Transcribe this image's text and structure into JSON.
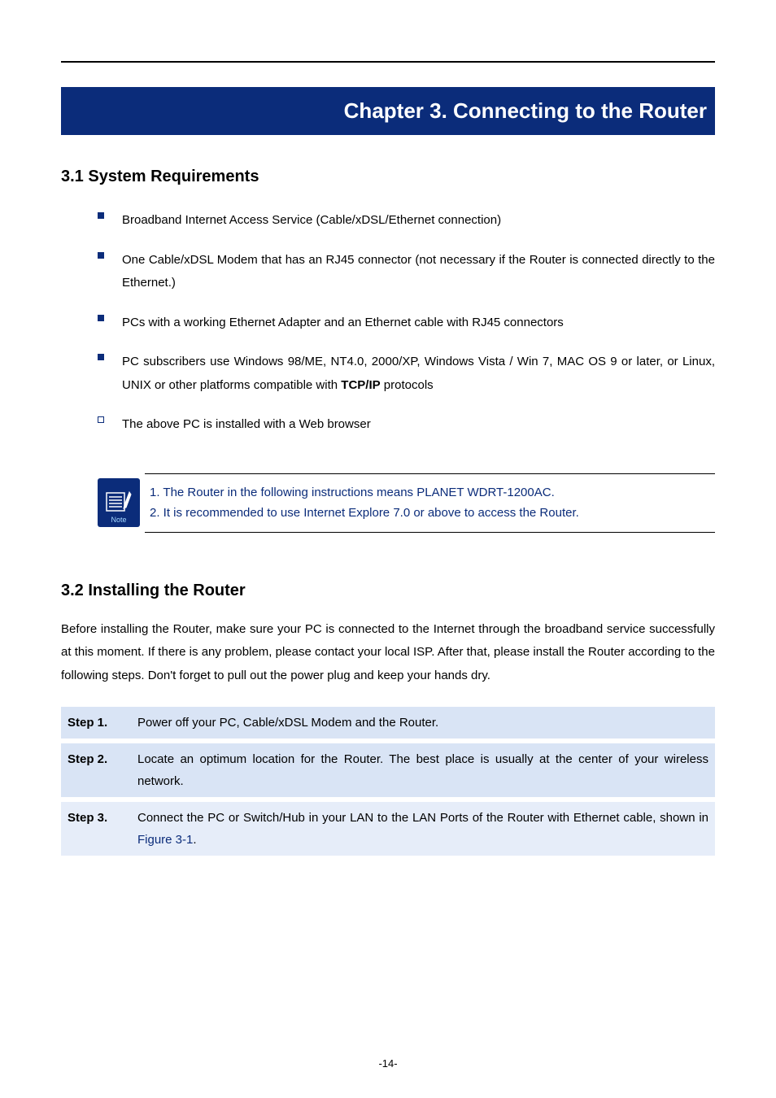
{
  "chapter": {
    "title": "Chapter 3. Connecting to the Router"
  },
  "s31": {
    "heading": "3.1  System Requirements",
    "items": {
      "i0": "Broadband Internet Access Service (Cable/xDSL/Ethernet connection)",
      "i1": "One Cable/xDSL Modem that has an RJ45 connector (not necessary if the Router is connected directly to the Ethernet.)",
      "i2": "PCs with a working Ethernet Adapter and an Ethernet cable with RJ45 connectors",
      "i3_pre": "PC subscribers use Windows 98/ME, NT4.0, 2000/XP, Windows Vista / Win 7, MAC OS 9 or later, or Linux, UNIX or other platforms compatible with ",
      "i3_bold": "TCP/IP",
      "i3_post": " protocols",
      "i4": "The above PC is installed with a Web browser"
    }
  },
  "note": {
    "label": "Note",
    "line1": "1. The Router in the following instructions means PLANET WDRT-1200AC.",
    "line2": "2. It is recommended to use Internet Explore 7.0 or above to access the Router."
  },
  "s32": {
    "heading": "3.2  Installing the Router",
    "intro": "Before installing the Router, make sure your PC is connected to the Internet through the broadband service successfully at this moment. If there is any problem, please contact your local ISP. After that, please install the Router according to the following steps. Don't forget to pull out the power plug and keep your hands dry.",
    "steps": {
      "s1_label": "Step 1.",
      "s1_text": "Power off your PC, Cable/xDSL Modem and the Router.",
      "s2_label": "Step 2.",
      "s2_text": "Locate an optimum location for the Router. The best place is usually at the center of your wireless network.",
      "s3_label": "Step 3.",
      "s3_pre": "Connect the PC or Switch/Hub in your LAN to the LAN Ports of the Router with Ethernet cable, shown in ",
      "s3_fig": "Figure 3-1",
      "s3_post": "."
    }
  },
  "pagenum": "-14-"
}
